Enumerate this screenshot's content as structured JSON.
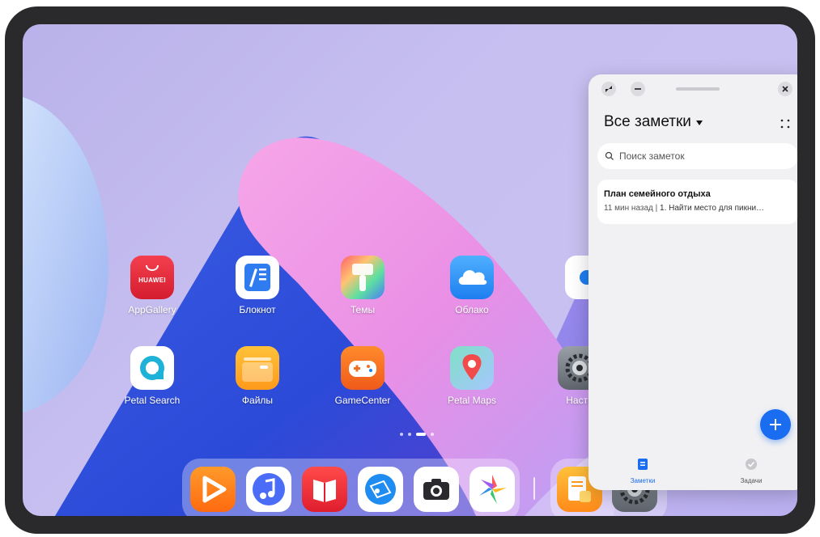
{
  "home": {
    "apps": [
      {
        "label": "AppGallery",
        "icon": "appgallery-icon",
        "badge": "HUAWEI"
      },
      {
        "label": "Блокнот",
        "icon": "notepad-icon"
      },
      {
        "label": "Темы",
        "icon": "themes-icon"
      },
      {
        "label": "Облако",
        "icon": "cloud-icon"
      },
      {
        "label": "Petal Search",
        "icon": "petal-search-icon"
      },
      {
        "label": "Файлы",
        "icon": "files-icon"
      },
      {
        "label": "GameCenter",
        "icon": "gamecenter-icon"
      },
      {
        "label": "Petal Maps",
        "icon": "petal-maps-icon"
      },
      {
        "label": "Настр",
        "icon": "settings-icon"
      }
    ],
    "page_indicator": {
      "pages": 4,
      "active": 3
    },
    "dock": [
      {
        "icon": "video-player-icon"
      },
      {
        "icon": "music-icon"
      },
      {
        "icon": "books-icon"
      },
      {
        "icon": "browser-icon"
      },
      {
        "icon": "camera-icon"
      },
      {
        "icon": "gallery-icon"
      }
    ],
    "dock_recent": [
      {
        "icon": "notes-app-icon"
      },
      {
        "icon": "settings-icon"
      }
    ]
  },
  "notes_window": {
    "title": "Все заметки",
    "search_placeholder": "Поиск заметок",
    "notes": [
      {
        "title": "План семейного отдыха",
        "time": "11 мин назад",
        "separator": " | ",
        "preview": "1. Найти место для пикни…"
      }
    ],
    "tabs": [
      {
        "label": "Заметки",
        "active": true
      },
      {
        "label": "Задачи",
        "active": false
      }
    ],
    "accent_color": "#1a6cf0"
  }
}
